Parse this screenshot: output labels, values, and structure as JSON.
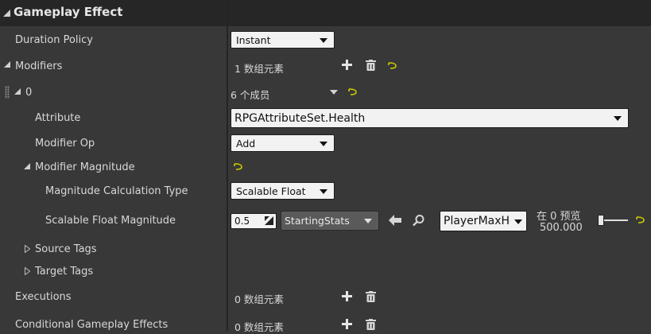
{
  "header": {
    "title": "Gameplay Effect"
  },
  "duration_policy": {
    "label": "Duration Policy",
    "value": "Instant"
  },
  "modifiers": {
    "label": "Modifiers",
    "count_text": "1 数组元素"
  },
  "modifier_0": {
    "label": "0",
    "members_text": "6 个成员"
  },
  "attribute": {
    "label": "Attribute",
    "value": "RPGAttributeSet.Health"
  },
  "modifier_op": {
    "label": "Modifier Op",
    "value": "Add"
  },
  "modifier_magnitude": {
    "label": "Modifier Magnitude"
  },
  "magnitude_calc_type": {
    "label": "Magnitude Calculation Type",
    "value": "Scalable Float"
  },
  "scalable_float": {
    "label": "Scalable Float Magnitude",
    "value": "0.5",
    "curve_table": "StartingStats",
    "row_name": "PlayerMaxHe",
    "preview_label": "在 0 预览",
    "preview_value": "500.000"
  },
  "source_tags": {
    "label": "Source Tags"
  },
  "target_tags": {
    "label": "Target Tags"
  },
  "executions": {
    "label": "Executions",
    "count_text": "0 数组元素"
  },
  "conditional_effects": {
    "label": "Conditional Gameplay Effects",
    "count_text": "0 数组元素"
  },
  "colors": {
    "reset_arrow": "#c8c800",
    "combo_bg": "#f2f2f2",
    "panel_bg": "#383838",
    "header_bg": "#262626"
  }
}
